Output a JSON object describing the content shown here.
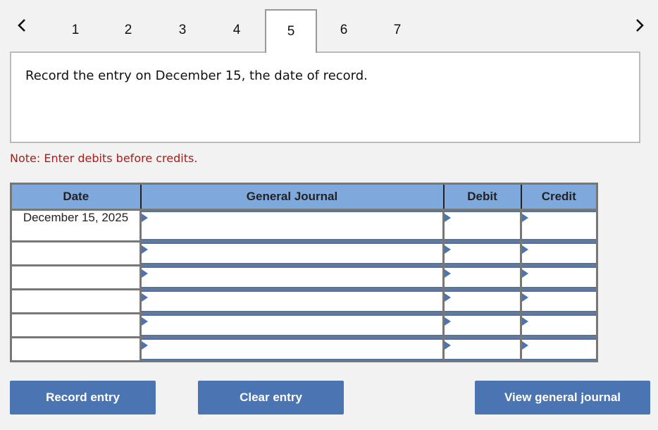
{
  "navigation": {
    "prev_icon": "chevron-left-icon",
    "next_icon": "chevron-right-icon",
    "tabs": [
      {
        "label": "1",
        "active": false
      },
      {
        "label": "2",
        "active": false
      },
      {
        "label": "3",
        "active": false
      },
      {
        "label": "4",
        "active": false
      },
      {
        "label": "5",
        "active": true
      },
      {
        "label": "6",
        "active": false
      },
      {
        "label": "7",
        "active": false
      }
    ]
  },
  "question": {
    "text": "Record the entry on December 15, the date of record."
  },
  "note": "Note: Enter debits before credits.",
  "journal": {
    "headers": {
      "date": "Date",
      "general_journal": "General Journal",
      "debit": "Debit",
      "credit": "Credit"
    },
    "rows": [
      {
        "date": "December 15, 2025",
        "account": "",
        "debit": "",
        "credit": ""
      },
      {
        "date": "",
        "account": "",
        "debit": "",
        "credit": ""
      },
      {
        "date": "",
        "account": "",
        "debit": "",
        "credit": ""
      },
      {
        "date": "",
        "account": "",
        "debit": "",
        "credit": ""
      },
      {
        "date": "",
        "account": "",
        "debit": "",
        "credit": ""
      },
      {
        "date": "",
        "account": "",
        "debit": "",
        "credit": ""
      }
    ]
  },
  "buttons": {
    "record_entry": "Record entry",
    "clear_entry": "Clear entry",
    "view_general_journal": "View general journal"
  },
  "colors": {
    "header_bg": "#7fa9dc",
    "button_bg": "#4a74b2",
    "note_text": "#a3201b",
    "input_accent": "#4a74b4"
  }
}
